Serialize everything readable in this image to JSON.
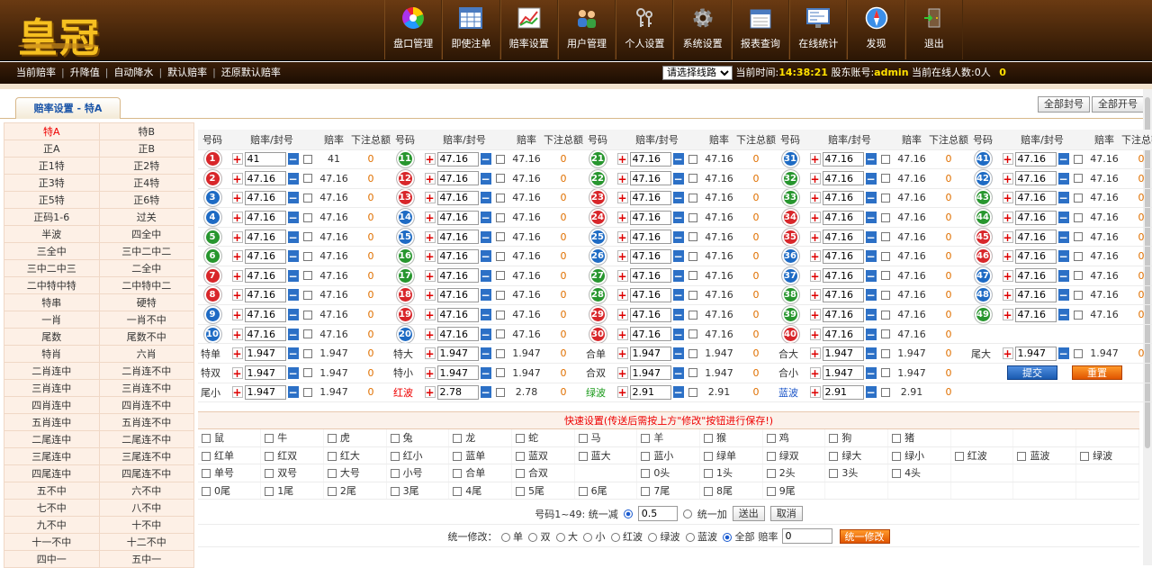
{
  "logo": "皇冠",
  "nav": [
    {
      "label": "盘口管理",
      "icon": "color-wheel-icon"
    },
    {
      "label": "即使注单",
      "icon": "spreadsheet-icon"
    },
    {
      "label": "赔率设置",
      "icon": "chart-icon"
    },
    {
      "label": "用户管理",
      "icon": "users-icon"
    },
    {
      "label": "个人设置",
      "icon": "keys-icon"
    },
    {
      "label": "系统设置",
      "icon": "gear-icon"
    },
    {
      "label": "报表查询",
      "icon": "calendar-icon"
    },
    {
      "label": "在线统计",
      "icon": "monitor-icon"
    },
    {
      "label": "发现",
      "icon": "compass-icon"
    },
    {
      "label": "退出",
      "icon": "exit-door-icon"
    }
  ],
  "subnav": [
    "当前赔率",
    "升降值",
    "自动降水",
    "默认赔率",
    "还原默认赔率"
  ],
  "status": {
    "line_select": "请选择线路",
    "time_label": "当前时间:",
    "time": "14:38:21",
    "account_label": "股东账号:",
    "account": "admin",
    "online_label": "当前在线人数:0人",
    "online_count": "0"
  },
  "tab": "赔率设置 - 特A",
  "top_buttons": [
    "全部封号",
    "全部开号"
  ],
  "sidebar": [
    [
      "特A",
      "特B"
    ],
    [
      "正A",
      "正B"
    ],
    [
      "正1特",
      "正2特"
    ],
    [
      "正3特",
      "正4特"
    ],
    [
      "正5特",
      "正6特"
    ],
    [
      "正码1-6",
      "过关"
    ],
    [
      "半波",
      "四全中"
    ],
    [
      "三全中",
      "三中二中二"
    ],
    [
      "三中二中三",
      "二全中"
    ],
    [
      "二中特中特",
      "二中特中二"
    ],
    [
      "特串",
      "硬特"
    ],
    [
      "一肖",
      "一肖不中"
    ],
    [
      "尾数",
      "尾数不中"
    ],
    [
      "特肖",
      "六肖"
    ],
    [
      "二肖连中",
      "二肖连不中"
    ],
    [
      "三肖连中",
      "三肖连不中"
    ],
    [
      "四肖连中",
      "四肖连不中"
    ],
    [
      "五肖连中",
      "五肖连不中"
    ],
    [
      "二尾连中",
      "二尾连不中"
    ],
    [
      "三尾连中",
      "三尾连不中"
    ],
    [
      "四尾连中",
      "四尾连不中"
    ],
    [
      "五不中",
      "六不中"
    ],
    [
      "七不中",
      "八不中"
    ],
    [
      "九不中",
      "十不中"
    ],
    [
      "十一不中",
      "十二不中"
    ],
    [
      "四中一",
      "五中一"
    ]
  ],
  "grid_headers": {
    "num": "号码",
    "odds_lock": "赔率/封号",
    "odds": "赔率",
    "total": "下注总额"
  },
  "numbers": [
    {
      "n": "1",
      "c": "r",
      "in": "41",
      "odds": "41",
      "total": "0"
    },
    {
      "n": "2",
      "c": "r",
      "in": "47.16",
      "odds": "47.16",
      "total": "0"
    },
    {
      "n": "3",
      "c": "b",
      "in": "47.16",
      "odds": "47.16",
      "total": "0"
    },
    {
      "n": "4",
      "c": "b",
      "in": "47.16",
      "odds": "47.16",
      "total": "0"
    },
    {
      "n": "5",
      "c": "g",
      "in": "47.16",
      "odds": "47.16",
      "total": "0"
    },
    {
      "n": "6",
      "c": "g",
      "in": "47.16",
      "odds": "47.16",
      "total": "0"
    },
    {
      "n": "7",
      "c": "r",
      "in": "47.16",
      "odds": "47.16",
      "total": "0"
    },
    {
      "n": "8",
      "c": "r",
      "in": "47.16",
      "odds": "47.16",
      "total": "0"
    },
    {
      "n": "9",
      "c": "b",
      "in": "47.16",
      "odds": "47.16",
      "total": "0"
    },
    {
      "n": "10",
      "c": "b",
      "in": "47.16",
      "odds": "47.16",
      "total": "0"
    },
    {
      "n": "11",
      "c": "g",
      "in": "47.16",
      "odds": "47.16",
      "total": "0"
    },
    {
      "n": "12",
      "c": "r",
      "in": "47.16",
      "odds": "47.16",
      "total": "0"
    },
    {
      "n": "13",
      "c": "r",
      "in": "47.16",
      "odds": "47.16",
      "total": "0"
    },
    {
      "n": "14",
      "c": "b",
      "in": "47.16",
      "odds": "47.16",
      "total": "0"
    },
    {
      "n": "15",
      "c": "b",
      "in": "47.16",
      "odds": "47.16",
      "total": "0"
    },
    {
      "n": "16",
      "c": "g",
      "in": "47.16",
      "odds": "47.16",
      "total": "0"
    },
    {
      "n": "17",
      "c": "g",
      "in": "47.16",
      "odds": "47.16",
      "total": "0"
    },
    {
      "n": "18",
      "c": "r",
      "in": "47.16",
      "odds": "47.16",
      "total": "0"
    },
    {
      "n": "19",
      "c": "r",
      "in": "47.16",
      "odds": "47.16",
      "total": "0"
    },
    {
      "n": "20",
      "c": "b",
      "in": "47.16",
      "odds": "47.16",
      "total": "0"
    },
    {
      "n": "21",
      "c": "g",
      "in": "47.16",
      "odds": "47.16",
      "total": "0"
    },
    {
      "n": "22",
      "c": "g",
      "in": "47.16",
      "odds": "47.16",
      "total": "0"
    },
    {
      "n": "23",
      "c": "r",
      "in": "47.16",
      "odds": "47.16",
      "total": "0"
    },
    {
      "n": "24",
      "c": "r",
      "in": "47.16",
      "odds": "47.16",
      "total": "0"
    },
    {
      "n": "25",
      "c": "b",
      "in": "47.16",
      "odds": "47.16",
      "total": "0"
    },
    {
      "n": "26",
      "c": "b",
      "in": "47.16",
      "odds": "47.16",
      "total": "0"
    },
    {
      "n": "27",
      "c": "g",
      "in": "47.16",
      "odds": "47.16",
      "total": "0"
    },
    {
      "n": "28",
      "c": "g",
      "in": "47.16",
      "odds": "47.16",
      "total": "0"
    },
    {
      "n": "29",
      "c": "r",
      "in": "47.16",
      "odds": "47.16",
      "total": "0"
    },
    {
      "n": "30",
      "c": "r",
      "in": "47.16",
      "odds": "47.16",
      "total": "0"
    },
    {
      "n": "31",
      "c": "b",
      "in": "47.16",
      "odds": "47.16",
      "total": "0"
    },
    {
      "n": "32",
      "c": "g",
      "in": "47.16",
      "odds": "47.16",
      "total": "0"
    },
    {
      "n": "33",
      "c": "g",
      "in": "47.16",
      "odds": "47.16",
      "total": "0"
    },
    {
      "n": "34",
      "c": "r",
      "in": "47.16",
      "odds": "47.16",
      "total": "0"
    },
    {
      "n": "35",
      "c": "r",
      "in": "47.16",
      "odds": "47.16",
      "total": "0"
    },
    {
      "n": "36",
      "c": "b",
      "in": "47.16",
      "odds": "47.16",
      "total": "0"
    },
    {
      "n": "37",
      "c": "b",
      "in": "47.16",
      "odds": "47.16",
      "total": "0"
    },
    {
      "n": "38",
      "c": "g",
      "in": "47.16",
      "odds": "47.16",
      "total": "0"
    },
    {
      "n": "39",
      "c": "g",
      "in": "47.16",
      "odds": "47.16",
      "total": "0"
    },
    {
      "n": "40",
      "c": "r",
      "in": "47.16",
      "odds": "47.16",
      "total": "0"
    },
    {
      "n": "41",
      "c": "b",
      "in": "47.16",
      "odds": "47.16",
      "total": "0"
    },
    {
      "n": "42",
      "c": "b",
      "in": "47.16",
      "odds": "47.16",
      "total": "0"
    },
    {
      "n": "43",
      "c": "g",
      "in": "47.16",
      "odds": "47.16",
      "total": "0"
    },
    {
      "n": "44",
      "c": "g",
      "in": "47.16",
      "odds": "47.16",
      "total": "0"
    },
    {
      "n": "45",
      "c": "r",
      "in": "47.16",
      "odds": "47.16",
      "total": "0"
    },
    {
      "n": "46",
      "c": "r",
      "in": "47.16",
      "odds": "47.16",
      "total": "0"
    },
    {
      "n": "47",
      "c": "b",
      "in": "47.16",
      "odds": "47.16",
      "total": "0"
    },
    {
      "n": "48",
      "c": "b",
      "in": "47.16",
      "odds": "47.16",
      "total": "0"
    },
    {
      "n": "49",
      "c": "g",
      "in": "47.16",
      "odds": "47.16",
      "total": "0"
    }
  ],
  "extras": [
    [
      {
        "label": "特单",
        "in": "1.947",
        "odds": "1.947",
        "total": "0"
      },
      {
        "label": "特大",
        "in": "1.947",
        "odds": "1.947",
        "total": "0"
      },
      {
        "label": "合单",
        "in": "1.947",
        "odds": "1.947",
        "total": "0"
      },
      {
        "label": "合大",
        "in": "1.947",
        "odds": "1.947",
        "total": "0"
      },
      {
        "label": "尾大",
        "in": "1.947",
        "odds": "1.947",
        "total": "0"
      }
    ],
    [
      {
        "label": "特双",
        "in": "1.947",
        "odds": "1.947",
        "total": "0"
      },
      {
        "label": "特小",
        "in": "1.947",
        "odds": "1.947",
        "total": "0"
      },
      {
        "label": "合双",
        "in": "1.947",
        "odds": "1.947",
        "total": "0"
      },
      {
        "label": "合小",
        "in": "1.947",
        "odds": "1.947",
        "total": "0"
      }
    ],
    [
      {
        "label": "尾小",
        "in": "1.947",
        "odds": "1.947",
        "total": "0"
      },
      {
        "label": "红波",
        "in": "2.78",
        "odds": "2.78",
        "total": "0",
        "color": "red"
      },
      {
        "label": "绿波",
        "in": "2.91",
        "odds": "2.91",
        "total": "0",
        "color": "grn"
      },
      {
        "label": "蓝波",
        "in": "2.91",
        "odds": "2.91",
        "total": "0",
        "color": "blu"
      }
    ]
  ],
  "submit_label": "提交",
  "reset_label": "重置",
  "quick_title": "快速设置(传送后需按上方\"修改\"按钮进行保存!)",
  "quick_rows": [
    [
      "鼠",
      "牛",
      "虎",
      "兔",
      "龙",
      "蛇",
      "马",
      "羊",
      "猴",
      "鸡",
      "狗",
      "猪",
      "",
      "",
      ""
    ],
    [
      "红单",
      "红双",
      "红大",
      "红小",
      "蓝单",
      "蓝双",
      "蓝大",
      "蓝小",
      "绿单",
      "绿双",
      "绿大",
      "绿小",
      "红波",
      "蓝波",
      "绿波"
    ],
    [
      "单号",
      "双号",
      "大号",
      "小号",
      "合单",
      "合双",
      "",
      "0头",
      "1头",
      "2头",
      "3头",
      "4头",
      "",
      "",
      ""
    ],
    [
      "0尾",
      "1尾",
      "2尾",
      "3尾",
      "4尾",
      "5尾",
      "6尾",
      "7尾",
      "8尾",
      "9尾",
      "",
      "",
      "",
      "",
      ""
    ]
  ],
  "batch": {
    "label": "号码1~49: 统一减",
    "value": "0.5",
    "add_label": "统一加",
    "send": "送出",
    "cancel": "取消"
  },
  "unify": {
    "label": "统一修改：",
    "options": [
      "单",
      "双",
      "大",
      "小",
      "红波",
      "绿波",
      "蓝波",
      "全部"
    ],
    "odds_label": "赔率",
    "odds_value": "0",
    "button": "统一修改"
  }
}
